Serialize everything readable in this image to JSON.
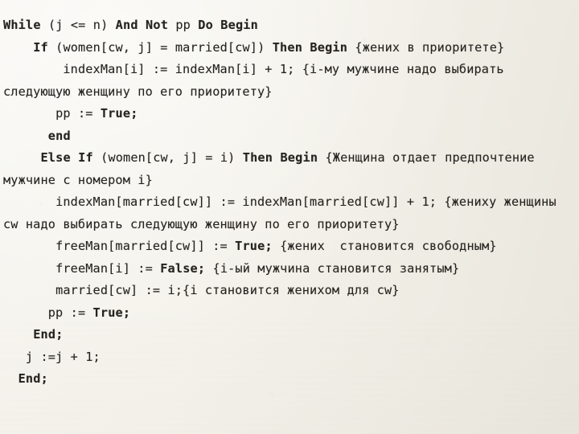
{
  "slide": {
    "kind": "pascal-code-listing",
    "background_color": "#f4f2eb",
    "text_color": "#24231f",
    "language": "Pascal",
    "comment_language": "Russian"
  },
  "code": {
    "lines": [
      {
        "id": "line-while",
        "indent": "",
        "tokens": [
          {
            "t": "While",
            "bold": true
          },
          {
            "t": " (j <= n) ",
            "bold": false
          },
          {
            "t": "And Not",
            "bold": true
          },
          {
            "t": " pp ",
            "bold": false
          },
          {
            "t": "Do Begin",
            "bold": true
          }
        ]
      },
      {
        "id": "line-if-married",
        "indent": "    ",
        "tokens": [
          {
            "t": "If",
            "bold": true
          },
          {
            "t": " (women[cw, j] = married[cw]) ",
            "bold": false
          },
          {
            "t": "Then Begin",
            "bold": true
          },
          {
            "t": " {жених в приоритете}",
            "bold": false
          }
        ]
      },
      {
        "id": "line-indexman-i",
        "indent": "        ",
        "tokens": [
          {
            "t": "indexMan[i] := indexMan[i] + 1; {i-му мужчине надо выбирать следующую женщину по его приоритету}",
            "bold": false
          }
        ]
      },
      {
        "id": "line-pp-true-1",
        "indent": "       ",
        "tokens": [
          {
            "t": "pp := ",
            "bold": false
          },
          {
            "t": "True;",
            "bold": true
          }
        ]
      },
      {
        "id": "line-end-lower",
        "indent": "      ",
        "tokens": [
          {
            "t": "end",
            "bold": true
          }
        ]
      },
      {
        "id": "line-else-if",
        "indent": "     ",
        "tokens": [
          {
            "t": "Else If",
            "bold": true
          },
          {
            "t": " (women[cw, j] = i) ",
            "bold": false
          },
          {
            "t": "Then Begin",
            "bold": true
          },
          {
            "t": " {Женщина отдает предпочтение мужчине с номером i}",
            "bold": false
          }
        ]
      },
      {
        "id": "line-indexman-married",
        "indent": "       ",
        "tokens": [
          {
            "t": "indexMan[married[cw]] := indexMan[married[cw]] + 1; {жениху женщины cw надо выбирать следующую женщину по его приоритету}",
            "bold": false
          }
        ]
      },
      {
        "id": "line-freeman-married",
        "indent": "       ",
        "tokens": [
          {
            "t": "freeMan[married[cw]] := ",
            "bold": false
          },
          {
            "t": "True;",
            "bold": true
          },
          {
            "t": " {жених  становится свободным}",
            "bold": false
          }
        ]
      },
      {
        "id": "line-freeman-i",
        "indent": "       ",
        "tokens": [
          {
            "t": "freeMan[i] := ",
            "bold": false
          },
          {
            "t": "False;",
            "bold": true
          },
          {
            "t": " {i-ый мужчина становится занятым}",
            "bold": false
          }
        ]
      },
      {
        "id": "line-married-assign",
        "indent": "       ",
        "tokens": [
          {
            "t": "married[cw] := i;{i становится женихом для cw}",
            "bold": false
          }
        ]
      },
      {
        "id": "line-pp-true-2",
        "indent": "      ",
        "tokens": [
          {
            "t": "pp := ",
            "bold": false
          },
          {
            "t": "True;",
            "bold": true
          }
        ]
      },
      {
        "id": "line-end-1",
        "indent": "    ",
        "tokens": [
          {
            "t": "End;",
            "bold": true
          }
        ]
      },
      {
        "id": "line-j-increment",
        "indent": "   ",
        "tokens": [
          {
            "t": "j :=j + 1;",
            "bold": false
          }
        ]
      },
      {
        "id": "line-end-2",
        "indent": "  ",
        "tokens": [
          {
            "t": "End;",
            "bold": true
          }
        ]
      }
    ]
  }
}
